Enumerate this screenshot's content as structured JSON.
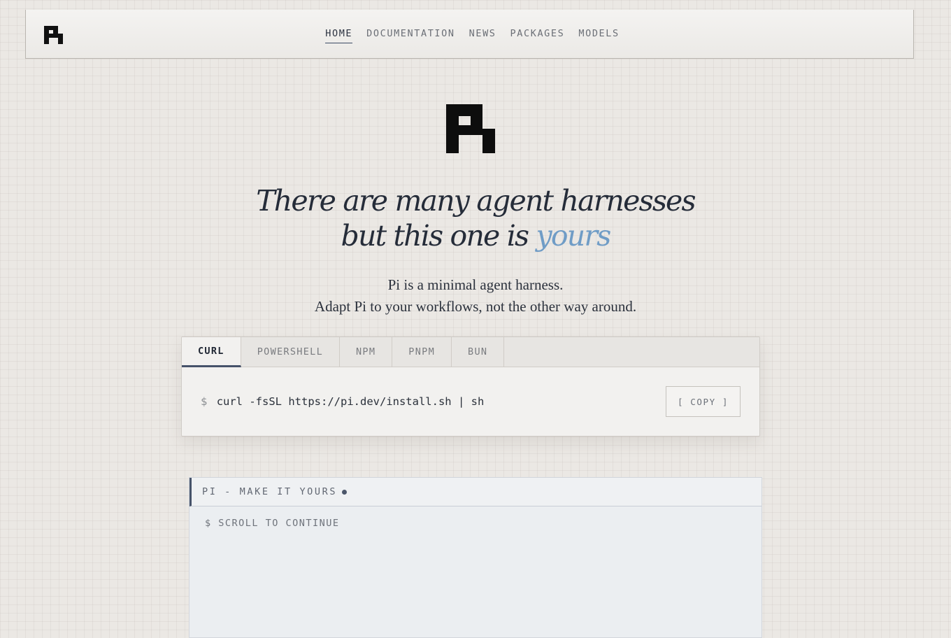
{
  "nav": {
    "links": [
      {
        "label": "HOME",
        "active": true
      },
      {
        "label": "DOCUMENTATION",
        "active": false
      },
      {
        "label": "NEWS",
        "active": false
      },
      {
        "label": "PACKAGES",
        "active": false
      },
      {
        "label": "MODELS",
        "active": false
      }
    ]
  },
  "hero": {
    "headline_line1": "There are many agent harnesses",
    "headline_line2_prefix": "but this one is ",
    "headline_line2_accent": "yours",
    "tagline_line1": "Pi is a minimal agent harness.",
    "tagline_line2": "Adapt Pi to your workflows, not the other way around."
  },
  "install": {
    "tabs": [
      {
        "label": "CURL",
        "active": true
      },
      {
        "label": "POWERSHELL",
        "active": false
      },
      {
        "label": "NPM",
        "active": false
      },
      {
        "label": "PNPM",
        "active": false
      },
      {
        "label": "BUN",
        "active": false
      }
    ],
    "prompt": "$",
    "command": "curl -fsSL https://pi.dev/install.sh | sh",
    "copy_label": "[ COPY ]"
  },
  "terminal": {
    "title": "PI - MAKE IT YOURS",
    "line": "$ SCROLL TO CONTINUE"
  },
  "colors": {
    "accent": "#6f9cc6",
    "ink": "#232a36",
    "active_tab_border": "#46536a"
  },
  "icons": {
    "logo": "pi-logo-icon",
    "status": "status-dot-icon"
  }
}
